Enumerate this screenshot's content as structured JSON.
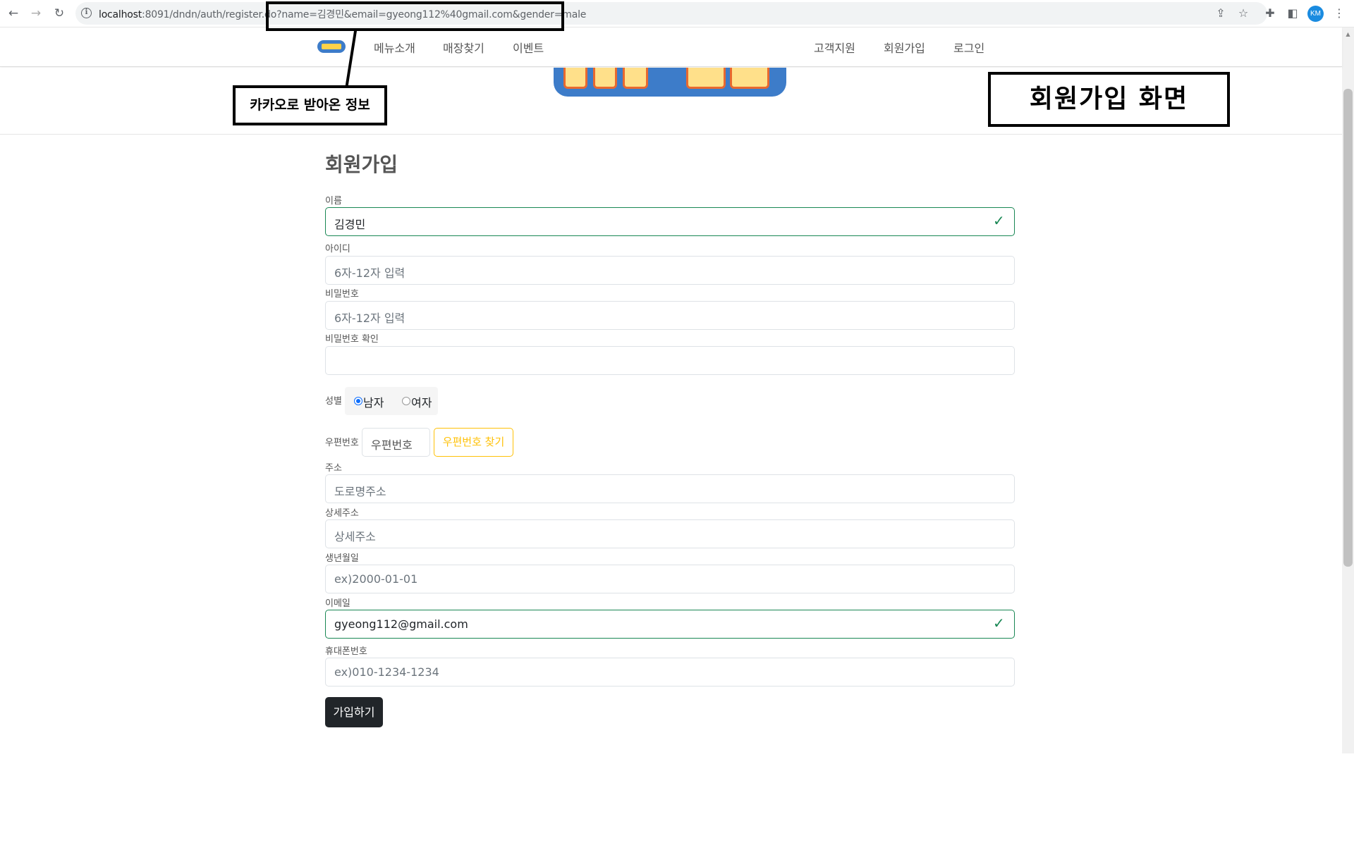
{
  "browser": {
    "url_host": "localhost",
    "url_path": ":8091/dndn/auth/register.do?name=김경민&email=gyeong112%40gmail.com&gender=male",
    "profile_initials": "KM"
  },
  "nav": {
    "links": [
      "메뉴소개",
      "매장찾기",
      "이벤트"
    ],
    "right_links": [
      "고객지원",
      "회원가입",
      "로그인"
    ]
  },
  "annotations": {
    "kakao_info": "카카오로 받아온 정보",
    "register_screen": "회원가입 화면"
  },
  "form": {
    "title": "회원가입",
    "name_label": "이름",
    "name_value": "김경민",
    "id_label": "아이디",
    "id_placeholder": "6자-12자 입력",
    "pw_label": "비밀번호",
    "pw_placeholder": "6자-12자 입력",
    "pw_confirm_label": "비밀번호 확인",
    "pw_confirm_placeholder": "",
    "gender_label": "성별",
    "gender_options": [
      "남자",
      "여자"
    ],
    "gender_selected": "남자",
    "zip_label": "우편번호",
    "zip_placeholder": "우편번호",
    "zip_button": "우편번호 찾기",
    "address_label": "주소",
    "address_placeholder": "도로명주소",
    "detail_label": "상세주소",
    "detail_placeholder": "상세주소",
    "birth_label": "생년월일",
    "birth_placeholder": "ex)2000-01-01",
    "email_label": "이메일",
    "email_value": "gyeong112@gmail.com",
    "phone_label": "휴대폰번호",
    "phone_placeholder": "ex)010-1234-1234",
    "submit_label": "가입하기"
  },
  "colors": {
    "valid": "#198754",
    "warning": "#ffc107",
    "primary": "#0d6efd",
    "dark_button": "#212529"
  }
}
